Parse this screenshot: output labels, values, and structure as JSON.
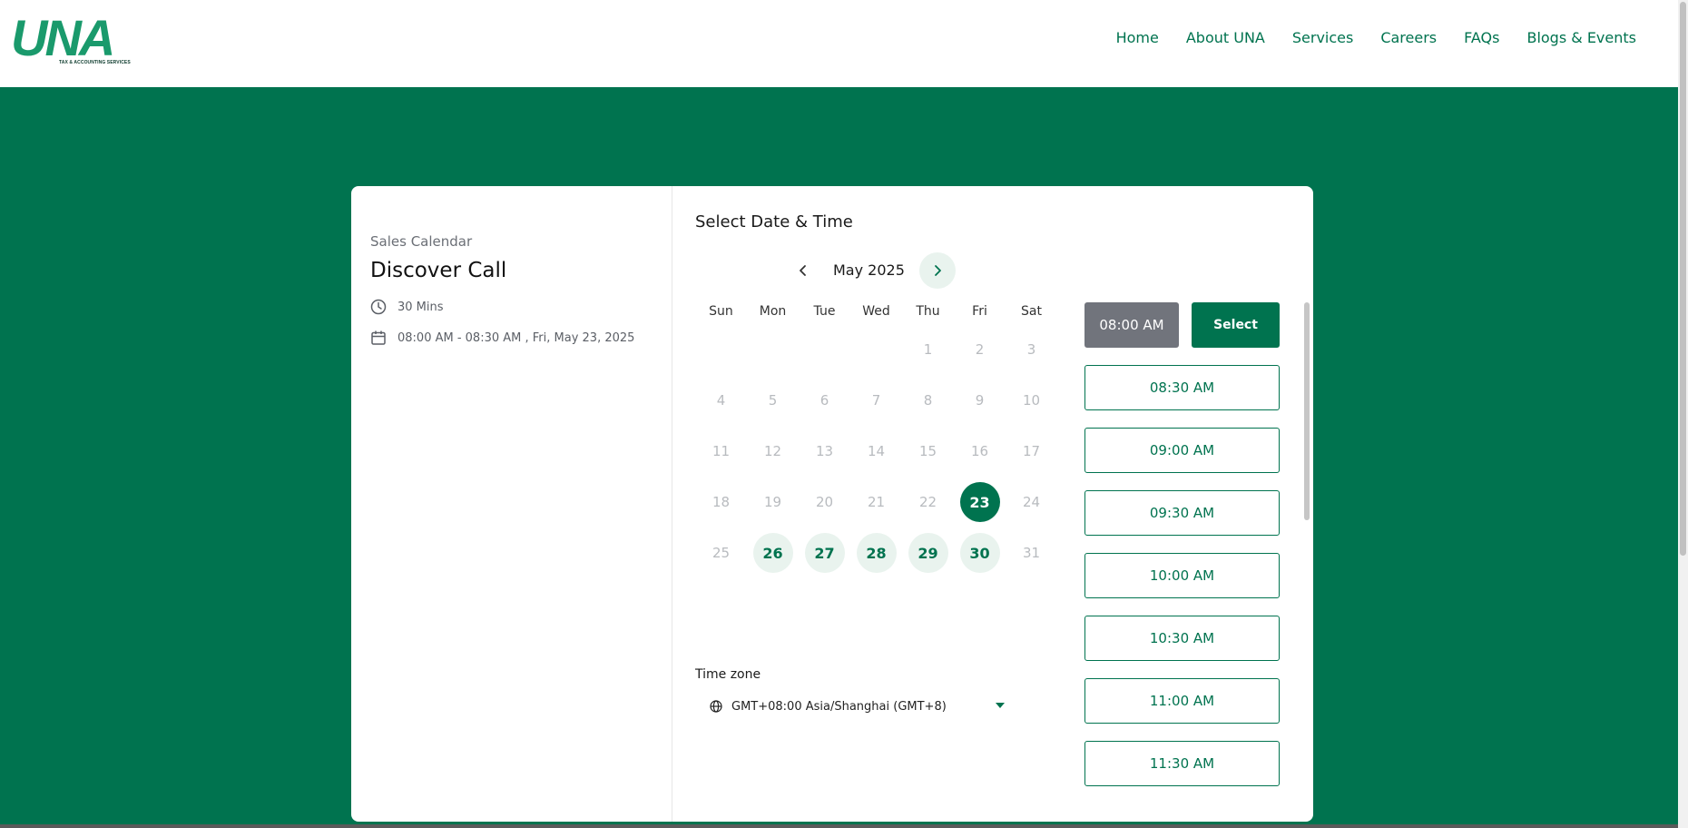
{
  "header": {
    "logo_text": "UNA",
    "logo_tagline": "TAX & ACCOUNTING SERVICES",
    "nav": [
      "Home",
      "About UNA",
      "Services",
      "Careers",
      "FAQs",
      "Blogs & Events"
    ]
  },
  "event": {
    "calendar_name": "Sales Calendar",
    "title": "Discover Call",
    "duration": "30 Mins",
    "datetime": "08:00 AM - 08:30 AM , Fri, May 23, 2025"
  },
  "picker": {
    "title": "Select Date & Time",
    "month": "May 2025",
    "weekdays": [
      "Sun",
      "Mon",
      "Tue",
      "Wed",
      "Thu",
      "Fri",
      "Sat"
    ],
    "weeks": [
      [
        "",
        "",
        "",
        "",
        "1",
        "2",
        "3"
      ],
      [
        "4",
        "5",
        "6",
        "7",
        "8",
        "9",
        "10"
      ],
      [
        "11",
        "12",
        "13",
        "14",
        "15",
        "16",
        "17"
      ],
      [
        "18",
        "19",
        "20",
        "21",
        "22",
        "23",
        "24"
      ],
      [
        "25",
        "26",
        "27",
        "28",
        "29",
        "30",
        "31"
      ]
    ],
    "available_days": [
      "26",
      "27",
      "28",
      "29",
      "30"
    ],
    "selected_day": "23",
    "timezone_label": "Time zone",
    "timezone_value": "GMT+08:00 Asia/Shanghai (GMT+8)"
  },
  "slots": {
    "selected": "08:00 AM",
    "select_label": "Select",
    "others": [
      "08:30 AM",
      "09:00 AM",
      "09:30 AM",
      "10:00 AM",
      "10:30 AM",
      "11:00 AM",
      "11:30 AM"
    ]
  },
  "colors": {
    "brand": "#00734f",
    "brand_light": "#e9f3ee",
    "chosen_slot": "#71747c"
  }
}
